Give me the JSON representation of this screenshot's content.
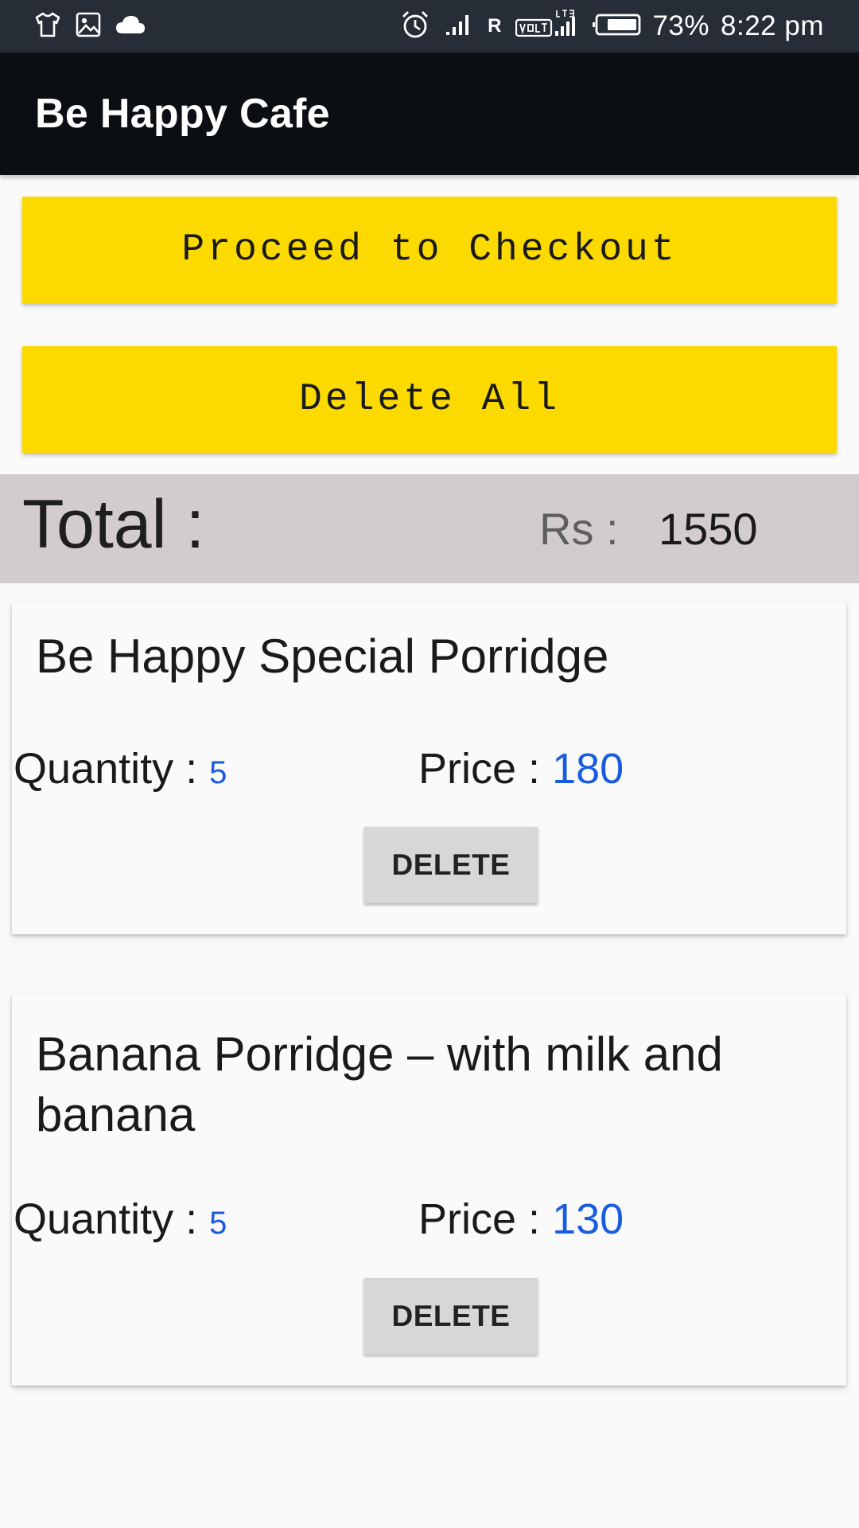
{
  "status_bar": {
    "icons_left": [
      "tshirt-icon",
      "image-icon",
      "cloud-icon"
    ],
    "icons_right": [
      "alarm-icon",
      "signal-icon",
      "volte-lte-signal-icon",
      "battery-icon"
    ],
    "roaming_label": "R",
    "battery_percent": "73%",
    "time": "8:22 pm"
  },
  "app_bar": {
    "title": "Be Happy Cafe"
  },
  "buttons": {
    "checkout_label": "Proceed to Checkout",
    "delete_all_label": "Delete All"
  },
  "total": {
    "label": "Total :",
    "currency_label": "Rs :",
    "value": "1550"
  },
  "cart_items": [
    {
      "name": "Be Happy Special Porridge",
      "quantity_label": "Quantity :",
      "quantity": "5",
      "price_label": "Price :",
      "price": "180",
      "delete_label": "DELETE"
    },
    {
      "name": "Banana Porridge – with milk and banana",
      "quantity_label": "Quantity :",
      "quantity": "5",
      "price_label": "Price :",
      "price": "130",
      "delete_label": "DELETE"
    }
  ],
  "colors": {
    "status_bar": "#272d37",
    "app_bar": "#0b0e13",
    "accent_button": "#fcda00",
    "total_bar": "#d2cccc",
    "value_blue": "#1a5ce0"
  }
}
